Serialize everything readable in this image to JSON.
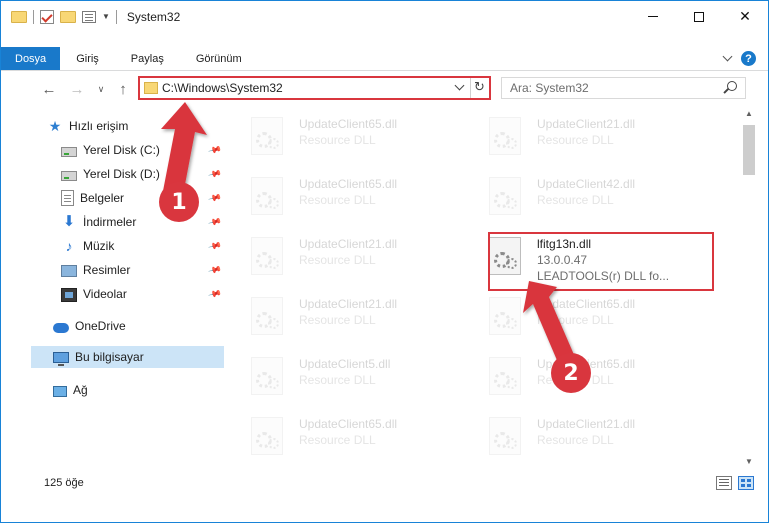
{
  "window": {
    "title": "System32"
  },
  "ribbon": {
    "tabs": [
      "Dosya",
      "Giriş",
      "Paylaş",
      "Görünüm"
    ]
  },
  "address": {
    "path": "C:\\Windows\\System32"
  },
  "search": {
    "placeholder": "Ara: System32"
  },
  "navpane": {
    "quick_access": "Hızlı erişim",
    "items": [
      {
        "label": "Yerel Disk (C:)",
        "icon": "hard-disk-icon",
        "pinned": true
      },
      {
        "label": "Yerel Disk (D:)",
        "icon": "hard-disk-icon",
        "pinned": true
      },
      {
        "label": "Belgeler",
        "icon": "documents-icon",
        "pinned": true
      },
      {
        "label": "İndirmeler",
        "icon": "download-icon",
        "pinned": true
      },
      {
        "label": "Müzik",
        "icon": "music-icon",
        "pinned": true
      },
      {
        "label": "Resimler",
        "icon": "pictures-icon",
        "pinned": true
      },
      {
        "label": "Videolar",
        "icon": "videos-icon",
        "pinned": true
      }
    ],
    "onedrive": "OneDrive",
    "this_pc": "Bu bilgisayar",
    "network": "Ağ"
  },
  "files": [
    {
      "name": "UpdateClient65.dll",
      "type": "Resource DLL"
    },
    {
      "name": "UpdateClient21.dll",
      "type": "Resource DLL"
    },
    {
      "name": "UpdateClient65.dll",
      "type": "Resource DLL"
    },
    {
      "name": "UpdateClient42.dll",
      "type": "Resource DLL"
    },
    {
      "name": "UpdateClient21.dll",
      "type": "Resource DLL"
    },
    {
      "name": "lfitg13n.dll",
      "version": "13.0.0.47",
      "description": "LEADTOOLS(r) DLL fo..."
    },
    {
      "name": "UpdateClient21.dll",
      "type": "Resource DLL"
    },
    {
      "name": "UpdateClient65.dll",
      "type": "Resource DLL"
    },
    {
      "name": "UpdateClient5.dll",
      "type": "Resource DLL"
    },
    {
      "name": "UpdateClient65.dll",
      "type": "Resource DLL"
    },
    {
      "name": "UpdateClient65.dll",
      "type": "Resource DLL"
    },
    {
      "name": "UpdateClient21.dll",
      "type": "Resource DLL"
    }
  ],
  "status": {
    "item_count": "125 öğe"
  },
  "annotations": {
    "step1": "1",
    "step2": "2",
    "accent_color": "#d9363e"
  },
  "colors": {
    "file_tab": "#1979ca",
    "selection": "#cce4f7"
  }
}
